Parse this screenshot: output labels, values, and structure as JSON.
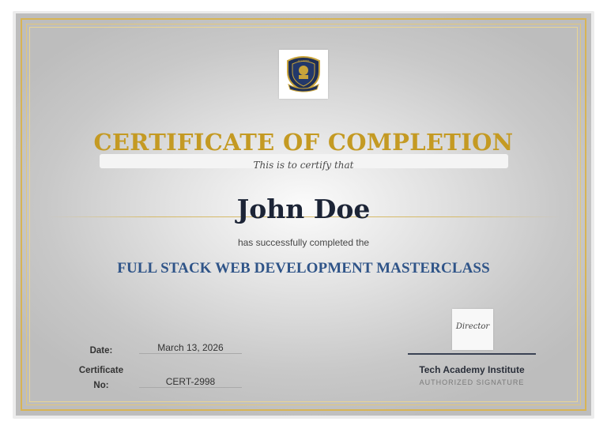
{
  "certificate": {
    "title": "CERTIFICATE OF COMPLETION",
    "certify_text": "This is to certify that",
    "recipient_name": "John Doe",
    "completed_text": "has successfully completed the",
    "course_name": "FULL STACK WEB DEVELOPMENT MASTERCLASS",
    "logo_icon": "academy-crest-icon",
    "details": {
      "date_label": "Date:",
      "date_value": "March 13, 2026",
      "cert_label_line1": "Certificate",
      "cert_label_line2": "No:",
      "cert_value": "CERT-2998"
    },
    "signature": {
      "image_text": "Director",
      "issuer": "Tech Academy Institute",
      "caption": "AUTHORIZED SIGNATURE"
    }
  },
  "colors": {
    "gold": "#c49a23",
    "frame_gold": "#d8b453",
    "navy_name": "#1c2436",
    "course_blue": "#2f5488"
  }
}
